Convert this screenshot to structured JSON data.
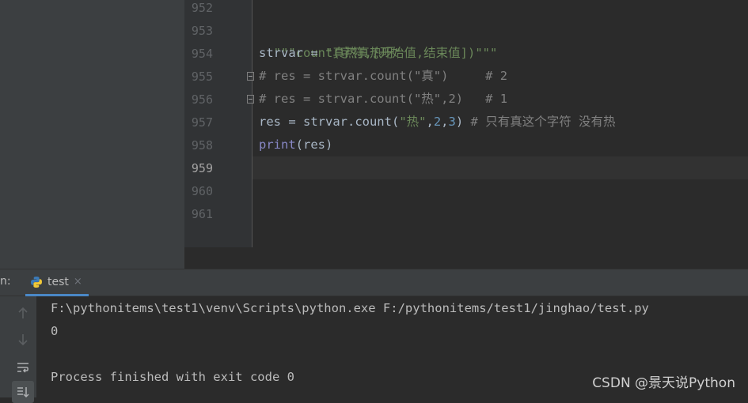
{
  "editor": {
    "line_numbers": [
      "952",
      "953",
      "954",
      "955",
      "956",
      "957",
      "958",
      "959",
      "960",
      "961"
    ],
    "lines": {
      "l953": {
        "docstring": "\"\"\"count(字符,[开始值,结束值])\"\"\""
      },
      "l954": {
        "code": "strvar = ",
        "string": "\"真热真热呀\""
      },
      "l955": {
        "comment": "# res = strvar.count(\"真\")     # 2"
      },
      "l956": {
        "comment": "# res = strvar.count(\"热\",2)   # 1"
      },
      "l957": {
        "code_a": "res = strvar.count(",
        "string": "\"热\"",
        "comma1": ",",
        "num1": "2",
        "comma2": ",",
        "num2": "3",
        "code_b": ") ",
        "comment": "# 只有真这个字符 没有热"
      },
      "l958": {
        "builtin": "print",
        "code": "(res)"
      }
    }
  },
  "run_panel": {
    "label": "n:",
    "tab_name": "test",
    "tab_close": "×",
    "console": [
      "F:\\pythonitems\\test1\\venv\\Scripts\\python.exe F:/pythonitems/test1/jinghao/test.py",
      "0",
      "",
      "Process finished with exit code 0"
    ]
  },
  "watermark": "CSDN @景天说Python",
  "icons": {
    "up": "arrow-up-icon",
    "down": "arrow-down-icon",
    "wrap": "soft-wrap-icon",
    "scroll": "scroll-to-end-icon"
  },
  "colors": {
    "editor_bg": "#2b2b2b",
    "string": "#6a8759",
    "comment": "#808080",
    "number": "#6897bb",
    "builtin": "#8888c6",
    "tab_accent": "#4a88c7"
  }
}
